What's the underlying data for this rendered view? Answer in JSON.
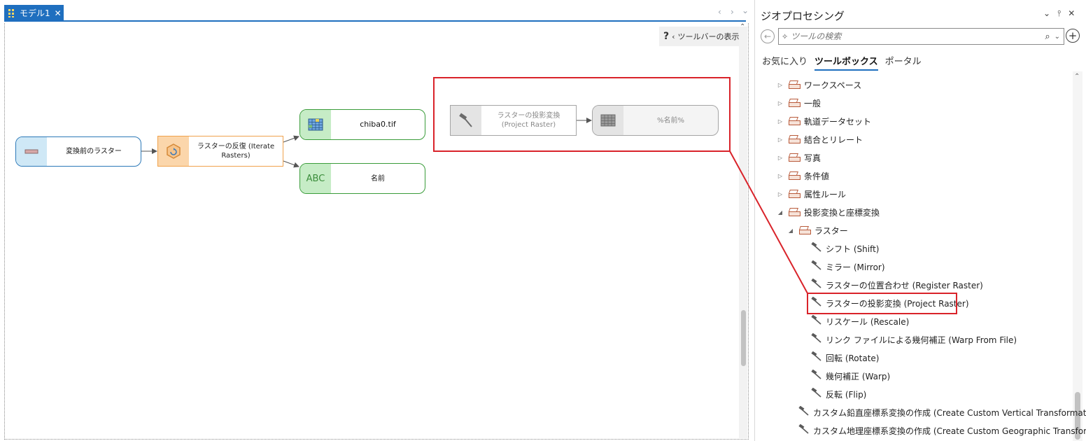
{
  "model_tab": {
    "label": "モデル1",
    "close": "✕"
  },
  "model_nav": {
    "prev": "‹",
    "next": "›",
    "menu": "⌄"
  },
  "canvas_toolbar": {
    "help": "?",
    "label": "ツールバーの表示",
    "chevron": "‹"
  },
  "nodes": {
    "input_raster": "変換前のラスター",
    "iterate": "ラスターの反復 (Iterate Rasters)",
    "chiba": "chiba0.tif",
    "name_icon": "ABC",
    "name": "名前",
    "project_raster": "ラスターの投影変換 (Project Raster)",
    "output": "%名前%"
  },
  "geoprocessing": {
    "title": "ジオプロセシング",
    "title_buttons": [
      "⌄",
      "⫯",
      "✕"
    ],
    "back": "←",
    "search_placeholder": "ツールの検索",
    "search_icon": "⌕",
    "search_dropdown": "⌄",
    "add": "+",
    "tabs": [
      {
        "label": "お気に入り",
        "active": false
      },
      {
        "label": "ツールボックス",
        "active": true
      },
      {
        "label": "ポータル",
        "active": false
      }
    ],
    "tree": [
      {
        "type": "toolbox",
        "expand": "▷",
        "label": "ワークスペース"
      },
      {
        "type": "toolbox",
        "expand": "▷",
        "label": "一般"
      },
      {
        "type": "toolbox",
        "expand": "▷",
        "label": "軌道データセット"
      },
      {
        "type": "toolbox",
        "expand": "▷",
        "label": "結合とリレート"
      },
      {
        "type": "toolbox",
        "expand": "▷",
        "label": "写真"
      },
      {
        "type": "toolbox",
        "expand": "▷",
        "label": "条件値"
      },
      {
        "type": "toolbox",
        "expand": "▷",
        "label": "属性ルール"
      },
      {
        "type": "toolbox",
        "expand": "◢",
        "label": "投影変換と座標変換"
      },
      {
        "type": "toolset",
        "expand": "◢",
        "label": "ラスター"
      },
      {
        "type": "tool",
        "label": "シフト (Shift)"
      },
      {
        "type": "tool",
        "label": "ミラー (Mirror)"
      },
      {
        "type": "tool",
        "label": "ラスターの位置合わせ (Register Raster)"
      },
      {
        "type": "tool",
        "label": "ラスターの投影変換 (Project Raster)",
        "highlighted": true
      },
      {
        "type": "tool",
        "label": "リスケール (Rescale)"
      },
      {
        "type": "tool",
        "label": "リンク ファイルによる幾何補正 (Warp From File)"
      },
      {
        "type": "tool",
        "label": "回転 (Rotate)"
      },
      {
        "type": "tool",
        "label": "幾何補正 (Warp)"
      },
      {
        "type": "tool",
        "label": "反転 (Flip)"
      },
      {
        "type": "tool2",
        "label": "カスタム鉛直座標系変換の作成 (Create Custom Vertical Transformation"
      },
      {
        "type": "tool2",
        "label": "カスタム地理座標系変換の作成 (Create Custom Geographic Transforma"
      }
    ]
  },
  "colors": {
    "accent": "#1f6fbf",
    "highlight_box": "#d9232a",
    "input_node": "#2c79b8",
    "iterator_node": "#f0a24c",
    "value_node": "#3a9c3a",
    "inactive_node": "#a5a5a5"
  },
  "icons": {
    "model_tab": "model-grid-icon",
    "tool": "hammer-icon",
    "toolbox": "toolbox-icon",
    "raster": "raster-grid-icon",
    "iterator": "iterate-hexagon-icon"
  }
}
